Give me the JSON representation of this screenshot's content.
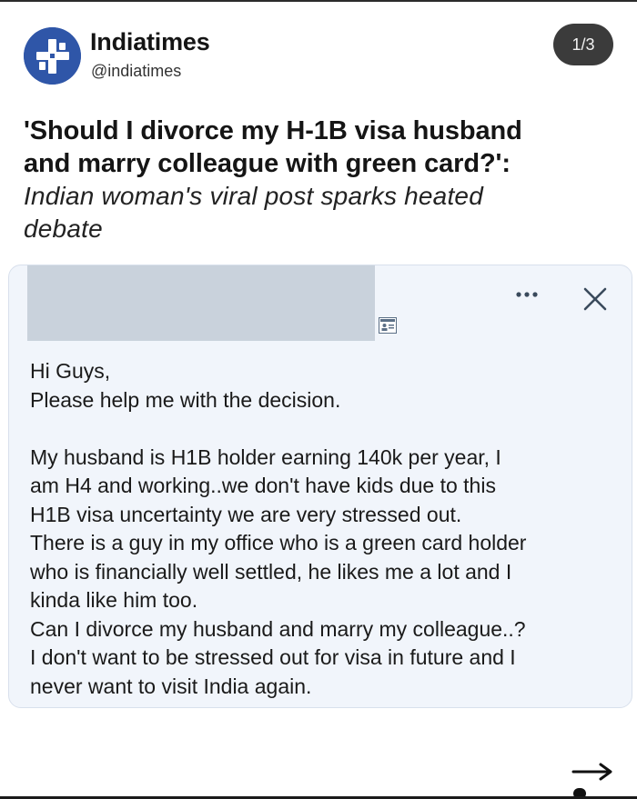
{
  "header": {
    "brand_name": "Indiatimes",
    "handle": "@indiatimes",
    "page_counter": "1/3",
    "logo_color": "#2f56a8"
  },
  "headline": {
    "bold_line_1": "'Should I divorce my H-1B visa husband",
    "bold_line_2": "and marry colleague with green card?':",
    "italic_line_1": "Indian woman's viral post sparks heated",
    "italic_line_2": "debate"
  },
  "post": {
    "greeting": "Hi Guys,",
    "request": "Please help me with the decision.",
    "body_lines": [
      "My husband is H1B holder earning 140k per year, I",
      "am H4 and working..we don't have kids due to this",
      "H1B visa uncertainty we are very stressed out.",
      "There is a guy in my office who is a green card holder",
      "who is financially well settled, he likes me a lot and I",
      "kinda like him too.",
      "Can I divorce my husband and marry my colleague..?",
      "I don't want to be stressed out for visa in future and I",
      "never want to visit India again."
    ],
    "card_background": "#f1f5fb"
  },
  "icons": {
    "more": "more-dots-icon",
    "close": "close-icon",
    "profile": "profile-card-icon",
    "next": "arrow-right-icon"
  }
}
